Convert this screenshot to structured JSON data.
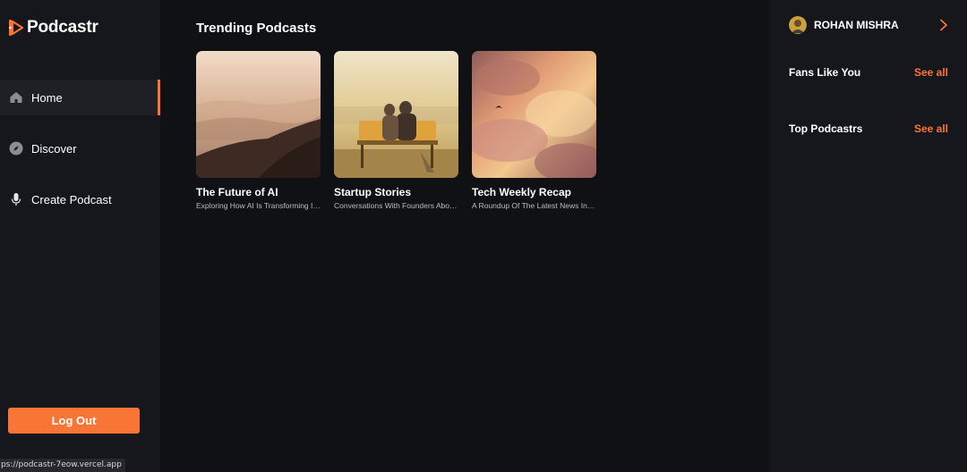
{
  "brand": {
    "name": "Podcastr",
    "accent": "#f97535"
  },
  "sidebar": {
    "items": [
      {
        "label": "Home",
        "icon": "home-icon",
        "active": true
      },
      {
        "label": "Discover",
        "icon": "compass-icon",
        "active": false
      },
      {
        "label": "Create Podcast",
        "icon": "microphone-icon",
        "active": false
      }
    ],
    "logout_label": "Log Out"
  },
  "status_bar": {
    "url": "ps://podcastr-7eow.vercel.app"
  },
  "main": {
    "section_title": "Trending Podcasts",
    "podcasts": [
      {
        "title": "The Future of AI",
        "description": "Exploring How AI Is Transforming Industries",
        "image": "misty-mountains"
      },
      {
        "title": "Startup Stories",
        "description": "Conversations With Founders About Their Journeys",
        "image": "couple-on-bench"
      },
      {
        "title": "Tech Weekly Recap",
        "description": "A Roundup Of The Latest News In Tech",
        "image": "sunset-clouds"
      }
    ]
  },
  "right_sidebar": {
    "user": {
      "name": "ROHAN MISHRA"
    },
    "sections": [
      {
        "title": "Fans Like You",
        "action": "See all"
      },
      {
        "title": "Top Podcastrs",
        "action": "See all"
      }
    ]
  }
}
